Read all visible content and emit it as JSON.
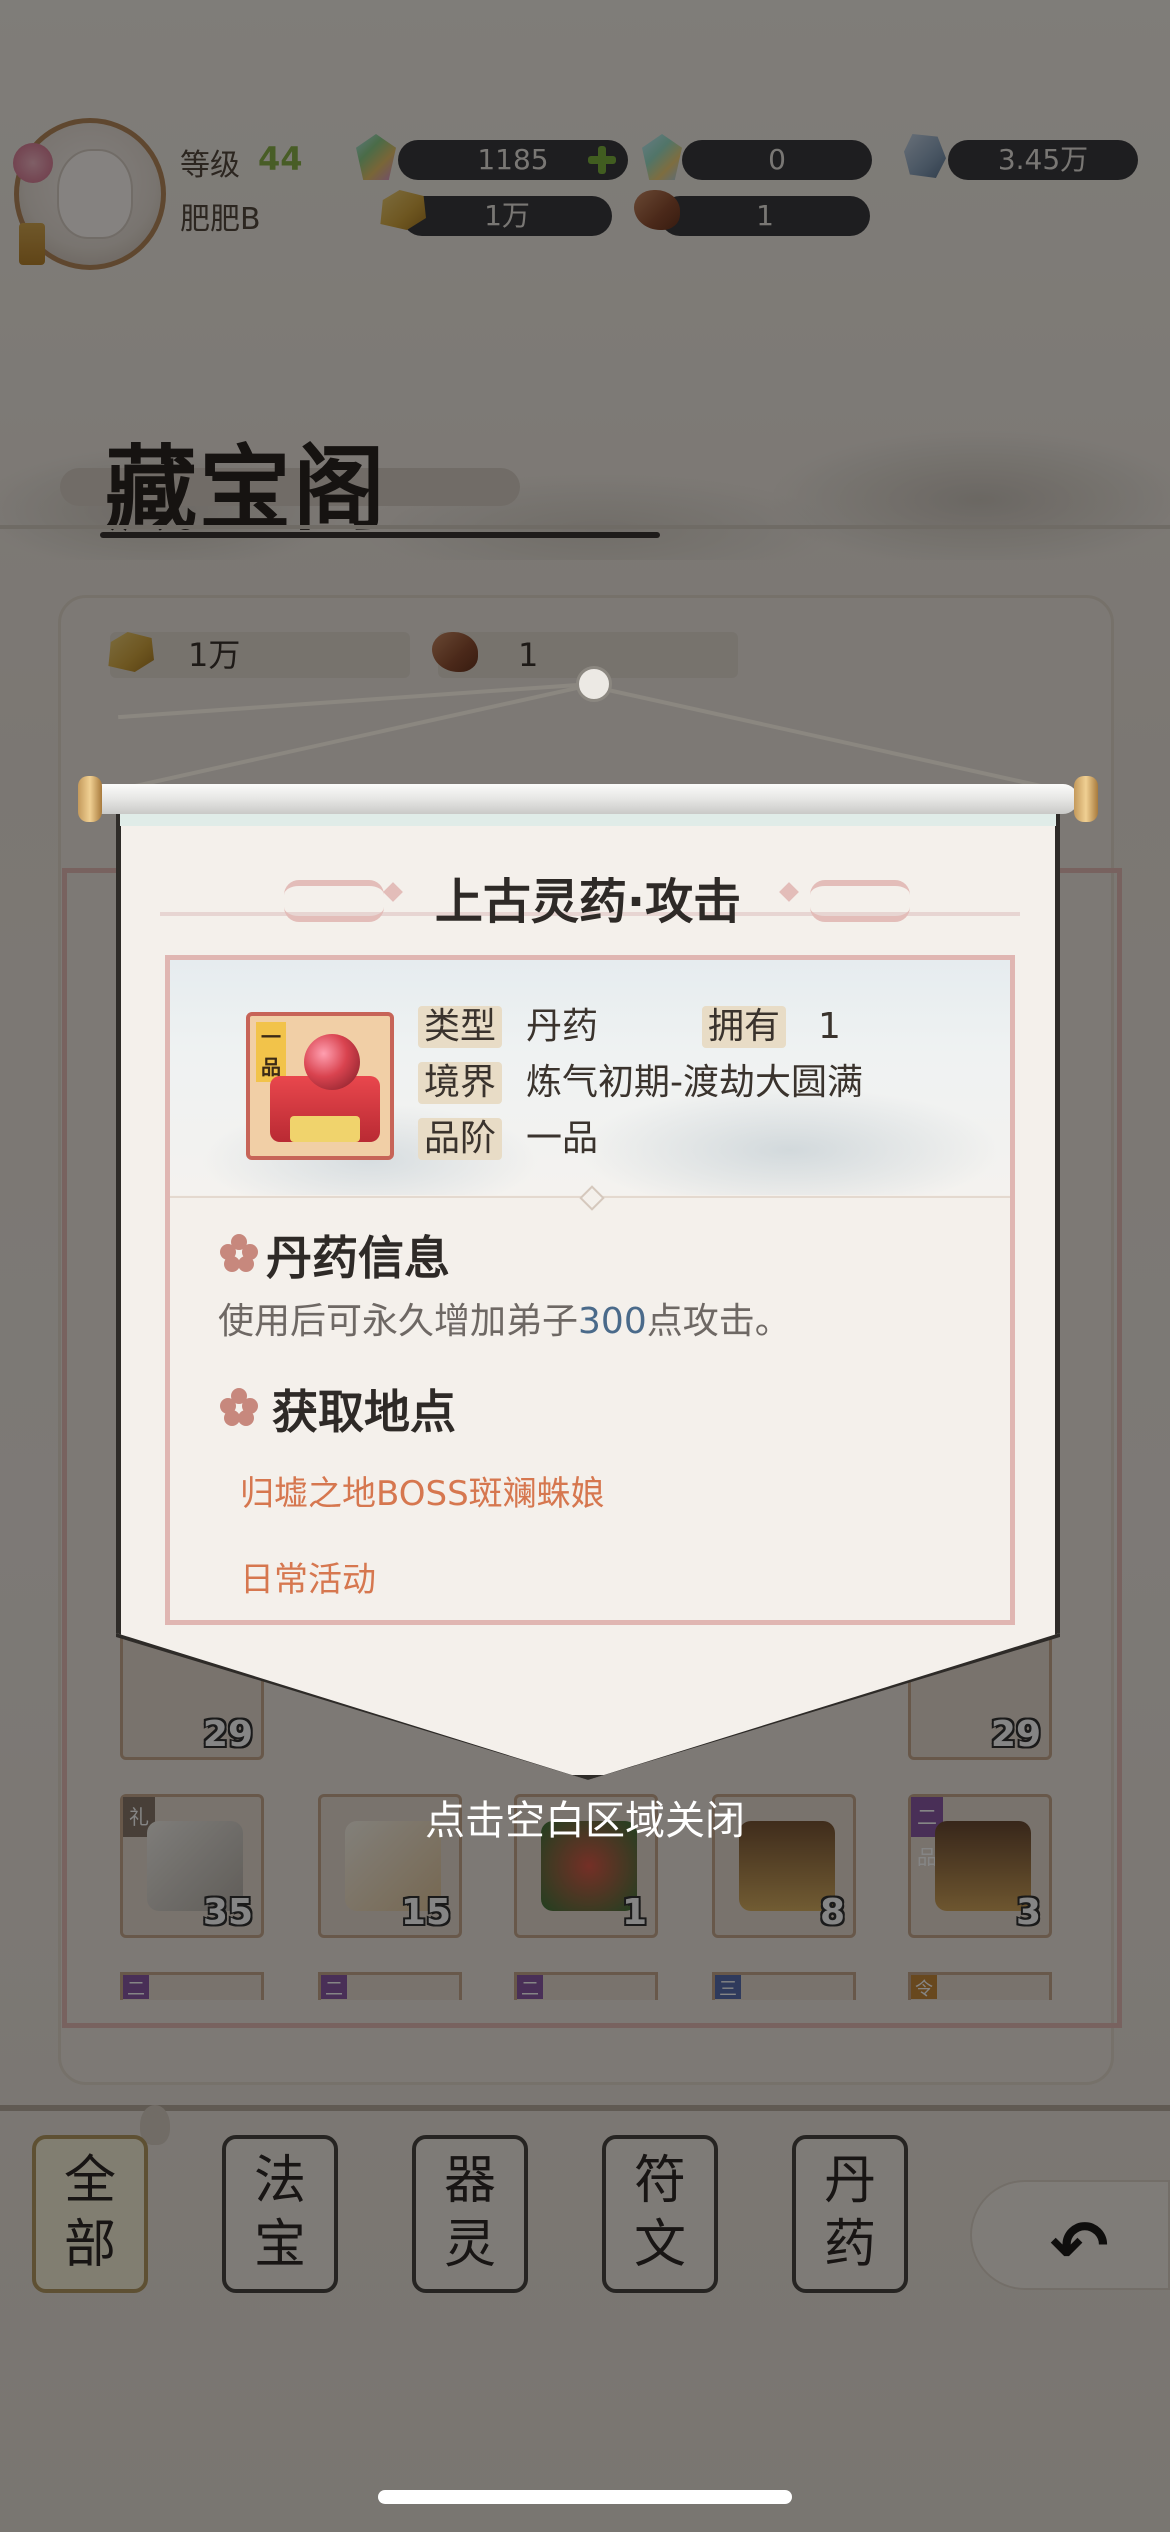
{
  "player": {
    "level_label": "等级",
    "level": "44",
    "name": "肥肥B"
  },
  "resources": {
    "gem": "1185",
    "gem2": "0",
    "stone": "3.45万",
    "gold": "1万",
    "wood": "1"
  },
  "page_title": "藏宝阁",
  "panel_resources": {
    "gold": "1万",
    "wood": "1"
  },
  "grid": {
    "row_top_counts": [
      "29",
      "29"
    ],
    "row2": [
      {
        "icon": "whip-icon",
        "count": "35",
        "tag": "礼"
      },
      {
        "icon": "scroll-item-icon",
        "count": "15",
        "tag": ""
      },
      {
        "icon": "herb-bundle-icon",
        "count": "1",
        "tag": ""
      },
      {
        "icon": "treasure-chest-icon",
        "count": "8",
        "tag": ""
      },
      {
        "icon": "treasure-chest-icon",
        "count": "3",
        "tag": "二品"
      }
    ],
    "row3_tags": [
      "二",
      "二",
      "二",
      "三",
      "令"
    ]
  },
  "popup": {
    "title": "上古灵药·攻击",
    "item_grade_badge": "一品",
    "type_label": "类型",
    "type_value": "丹药",
    "own_label": "拥有",
    "own_value": "1",
    "realm_label": "境界",
    "realm_value": "炼气初期-渡劫大圆满",
    "quality_label": "品阶",
    "quality_value": "一品",
    "info_title": "丹药信息",
    "desc_prefix": "使用后可永久增加弟子",
    "desc_highlight": "300",
    "desc_suffix": "点攻击。",
    "source_title": "获取地点",
    "sources": [
      "归墟之地BOSS斑斓蛛娘",
      "日常活动"
    ],
    "close_hint": "点击空白区域关闭"
  },
  "tabs": [
    {
      "line1": "全",
      "line2": "部",
      "active": true
    },
    {
      "line1": "法",
      "line2": "宝",
      "active": false
    },
    {
      "line1": "器",
      "line2": "灵",
      "active": false
    },
    {
      "line1": "符",
      "line2": "文",
      "active": false
    },
    {
      "line1": "丹",
      "line2": "药",
      "active": false
    }
  ],
  "colors": {
    "accent_green": "#8bb34a",
    "source_orange": "#d6774f",
    "highlight_blue": "#4a6a8a",
    "frame_pink": "#e0b6b2"
  }
}
